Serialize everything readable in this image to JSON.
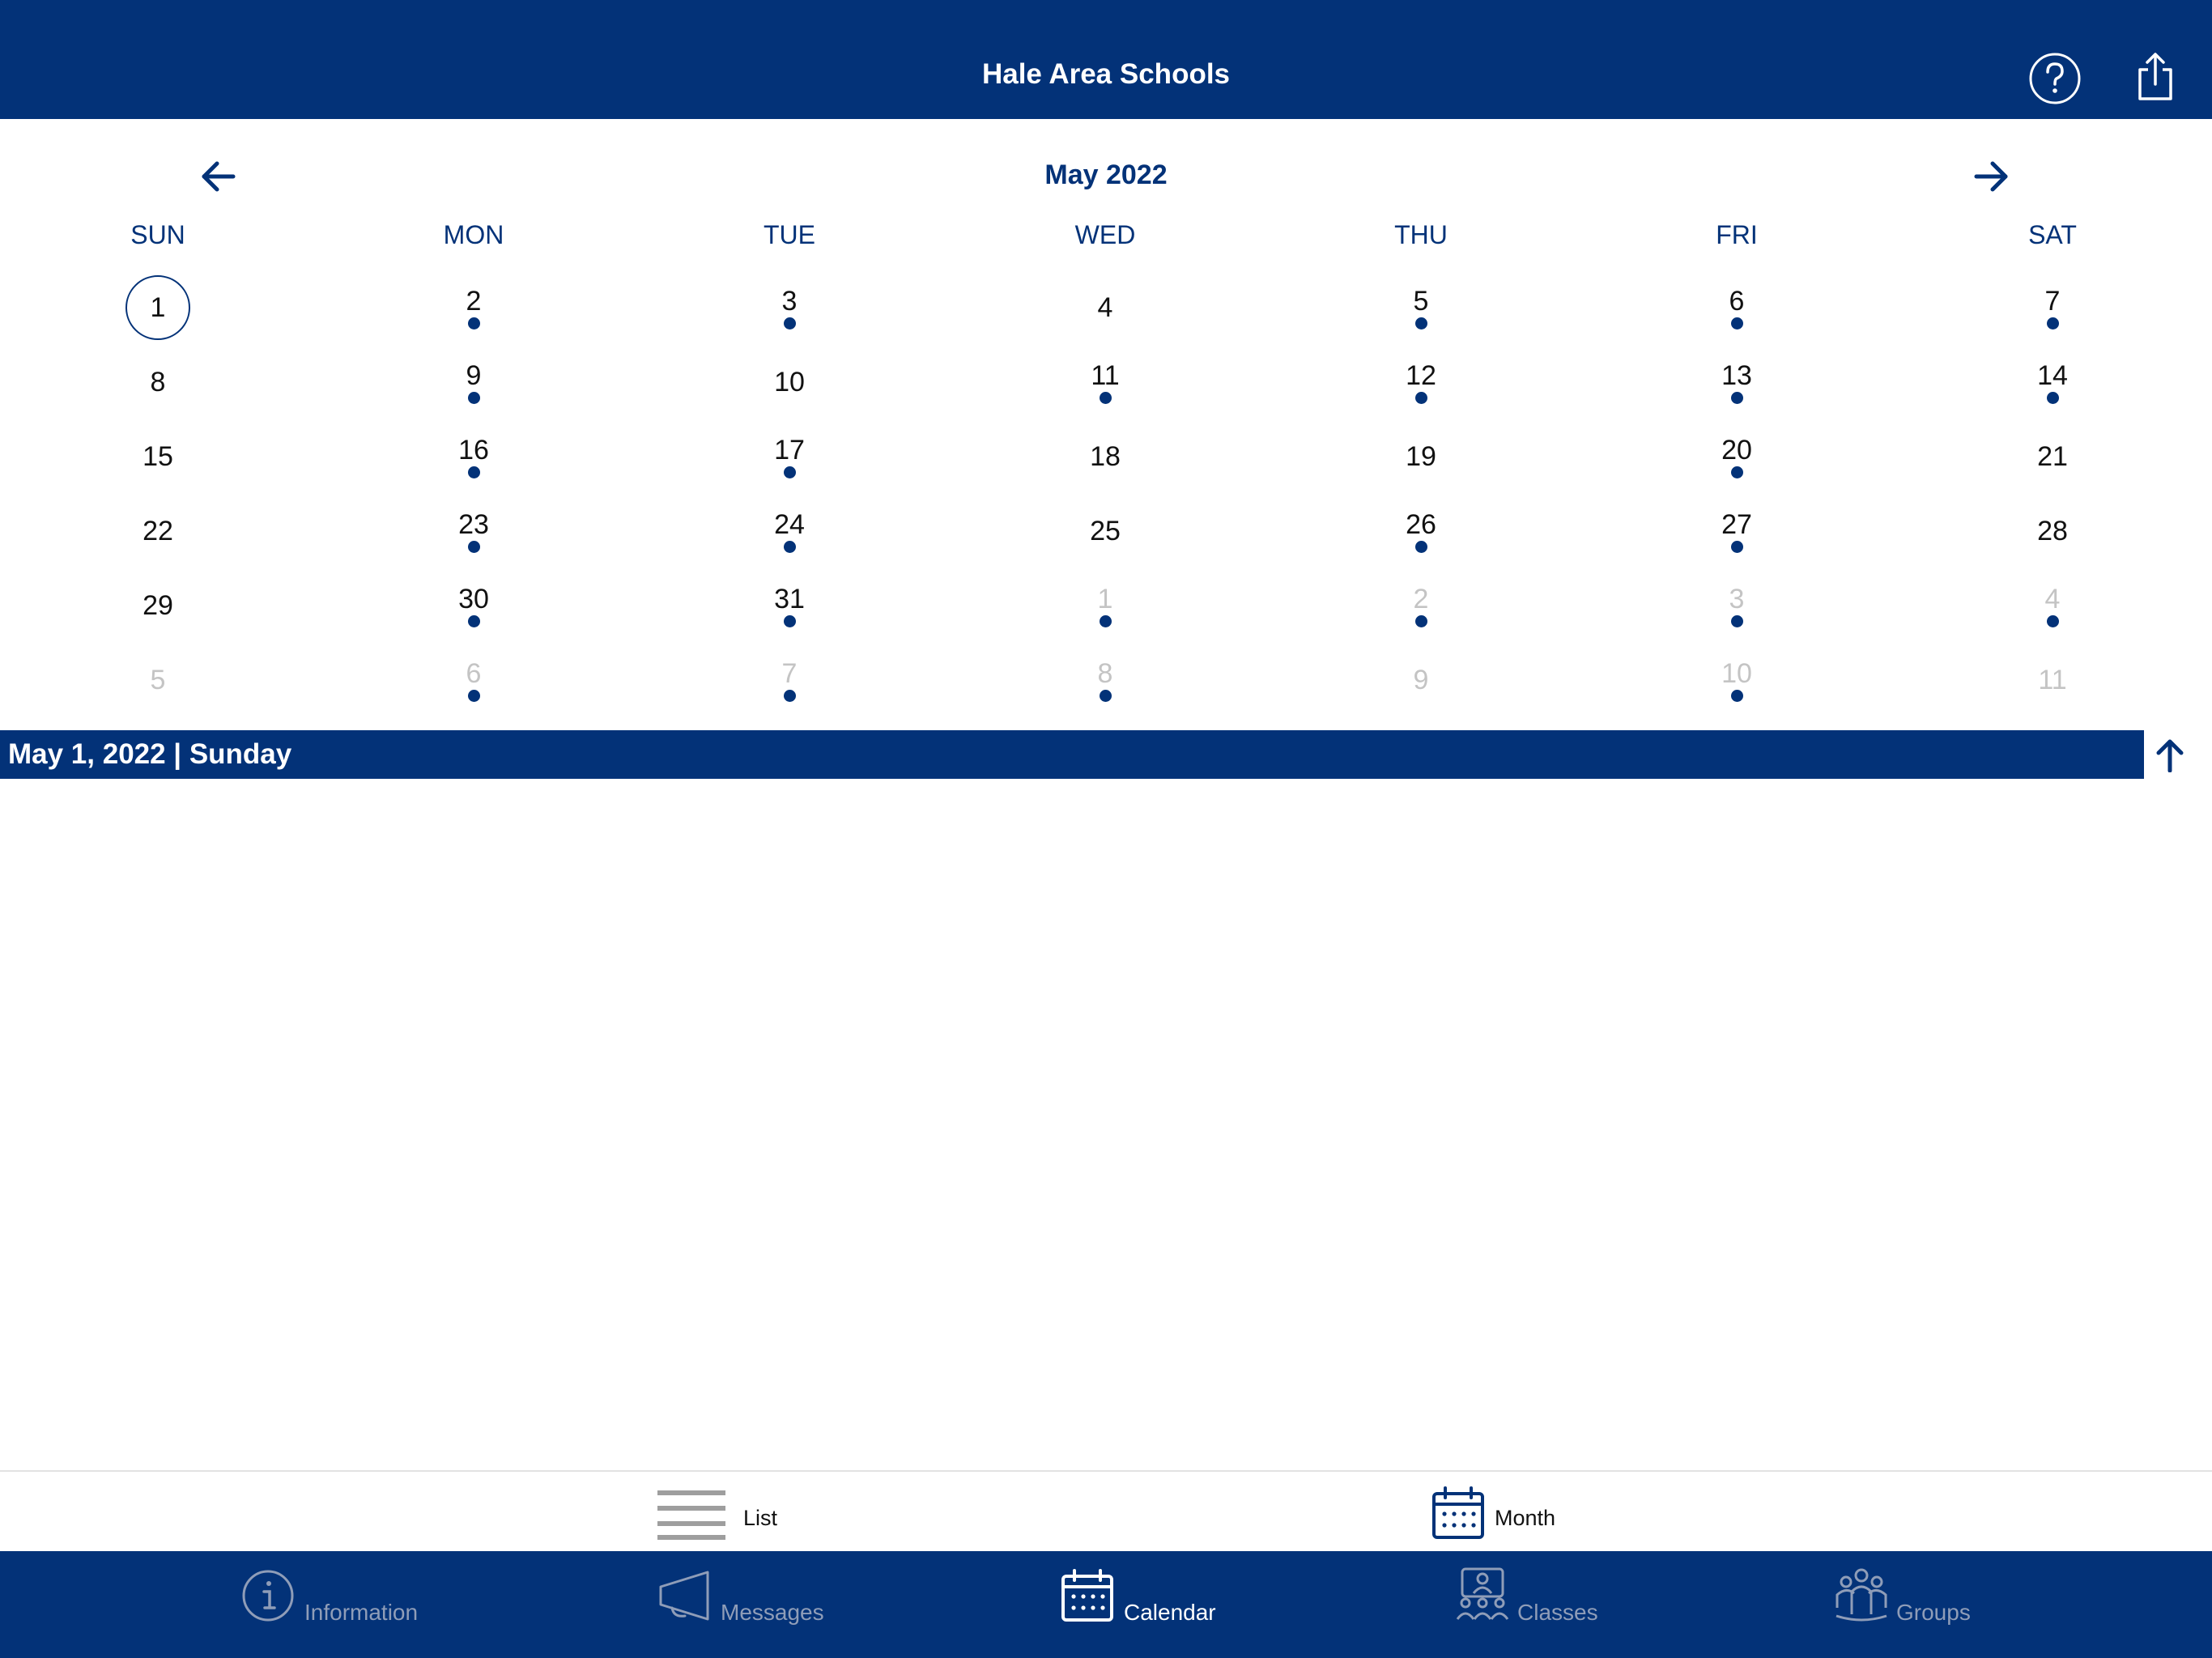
{
  "header": {
    "title": "Hale Area Schools",
    "help_icon": "question-circle-icon",
    "share_icon": "share-icon"
  },
  "calendar": {
    "month_title": "May 2022",
    "prev_icon": "arrow-left-icon",
    "next_icon": "arrow-right-icon",
    "weekdays": [
      "SUN",
      "MON",
      "TUE",
      "WED",
      "THU",
      "FRI",
      "SAT"
    ],
    "selected_day": "1",
    "weeks": [
      [
        {
          "d": "1",
          "cur": true,
          "dot": false,
          "sel": true
        },
        {
          "d": "2",
          "cur": true,
          "dot": true
        },
        {
          "d": "3",
          "cur": true,
          "dot": true
        },
        {
          "d": "4",
          "cur": true,
          "dot": false
        },
        {
          "d": "5",
          "cur": true,
          "dot": true
        },
        {
          "d": "6",
          "cur": true,
          "dot": true
        },
        {
          "d": "7",
          "cur": true,
          "dot": true
        }
      ],
      [
        {
          "d": "8",
          "cur": true,
          "dot": false
        },
        {
          "d": "9",
          "cur": true,
          "dot": true
        },
        {
          "d": "10",
          "cur": true,
          "dot": false
        },
        {
          "d": "11",
          "cur": true,
          "dot": true
        },
        {
          "d": "12",
          "cur": true,
          "dot": true
        },
        {
          "d": "13",
          "cur": true,
          "dot": true
        },
        {
          "d": "14",
          "cur": true,
          "dot": true
        }
      ],
      [
        {
          "d": "15",
          "cur": true,
          "dot": false
        },
        {
          "d": "16",
          "cur": true,
          "dot": true
        },
        {
          "d": "17",
          "cur": true,
          "dot": true
        },
        {
          "d": "18",
          "cur": true,
          "dot": false
        },
        {
          "d": "19",
          "cur": true,
          "dot": false
        },
        {
          "d": "20",
          "cur": true,
          "dot": true
        },
        {
          "d": "21",
          "cur": true,
          "dot": false
        }
      ],
      [
        {
          "d": "22",
          "cur": true,
          "dot": false
        },
        {
          "d": "23",
          "cur": true,
          "dot": true
        },
        {
          "d": "24",
          "cur": true,
          "dot": true
        },
        {
          "d": "25",
          "cur": true,
          "dot": false
        },
        {
          "d": "26",
          "cur": true,
          "dot": true
        },
        {
          "d": "27",
          "cur": true,
          "dot": true
        },
        {
          "d": "28",
          "cur": true,
          "dot": false
        }
      ],
      [
        {
          "d": "29",
          "cur": true,
          "dot": false
        },
        {
          "d": "30",
          "cur": true,
          "dot": true
        },
        {
          "d": "31",
          "cur": true,
          "dot": true
        },
        {
          "d": "1",
          "cur": false,
          "dot": true
        },
        {
          "d": "2",
          "cur": false,
          "dot": true
        },
        {
          "d": "3",
          "cur": false,
          "dot": true
        },
        {
          "d": "4",
          "cur": false,
          "dot": true
        }
      ],
      [
        {
          "d": "5",
          "cur": false,
          "dot": false
        },
        {
          "d": "6",
          "cur": false,
          "dot": true
        },
        {
          "d": "7",
          "cur": false,
          "dot": true
        },
        {
          "d": "8",
          "cur": false,
          "dot": true
        },
        {
          "d": "9",
          "cur": false,
          "dot": false
        },
        {
          "d": "10",
          "cur": false,
          "dot": true
        },
        {
          "d": "11",
          "cur": false,
          "dot": false
        }
      ]
    ]
  },
  "selected_date_bar": {
    "label": "May 1, 2022 | Sunday",
    "collapse_icon": "arrow-up-icon"
  },
  "view_toggle": {
    "list": {
      "label": "List",
      "icon": "list-icon"
    },
    "month": {
      "label": "Month",
      "icon": "calendar-icon",
      "active": true
    }
  },
  "tabbar": {
    "tabs": [
      {
        "label": "Information",
        "icon": "info-circle-icon",
        "active": false
      },
      {
        "label": "Messages",
        "icon": "megaphone-icon",
        "active": false
      },
      {
        "label": "Calendar",
        "icon": "calendar-icon",
        "active": true
      },
      {
        "label": "Classes",
        "icon": "classroom-icon",
        "active": false
      },
      {
        "label": "Groups",
        "icon": "groups-icon",
        "active": false
      }
    ]
  },
  "colors": {
    "brand_navy": "#033278",
    "inactive_tab_text": "#8f9db8",
    "other_month_day": "#c4c4c4"
  }
}
